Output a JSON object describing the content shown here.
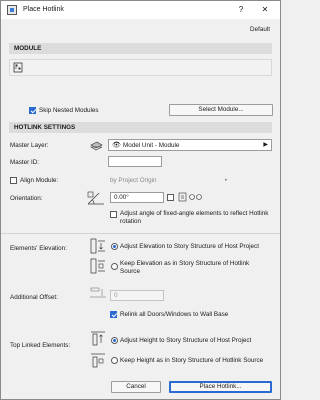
{
  "window": {
    "title": "Place Hotlink",
    "help_glyph": "?",
    "close_glyph": "✕",
    "default_label": "Default"
  },
  "module": {
    "header": "MODULE",
    "skip_nested_label": "Skip Nested Modules",
    "skip_nested_checked": true,
    "select_button": "Select Module..."
  },
  "hotlink": {
    "header": "HOTLINK SETTINGS",
    "master_layer_label": "Master Layer:",
    "master_layer_value": "Model Unit - Module",
    "master_id_label": "Master ID:",
    "master_id_value": "",
    "align_label": "Align Module:",
    "align_value": "by Project Origin",
    "orientation_label": "Orientation:",
    "orientation_value": "0.00°",
    "adjust_angle_label": "Adjust angle of fixed-angle elements to reflect Hotlink rotation"
  },
  "elevation": {
    "label": "Elements' Elevation:",
    "opt1": "Adjust Elevation to Story Structure of Host Project",
    "opt2": "Keep Elevation as in Story Structure of Hotlink Source"
  },
  "offset": {
    "label": "Additional Offset:",
    "value": "0"
  },
  "relink": {
    "label": "Relink all Doors/Windows to Wall Base",
    "checked": true
  },
  "top_linked": {
    "label": "Top Linked Elements:",
    "opt1": "Adjust Height to Story Structure of Host Project",
    "opt2": "Keep Height as in Story Structure of Hotlink Source"
  },
  "footer": {
    "cancel": "Cancel",
    "place": "Place Hotlink..."
  },
  "colors": {
    "accent": "#2b6bd0"
  }
}
